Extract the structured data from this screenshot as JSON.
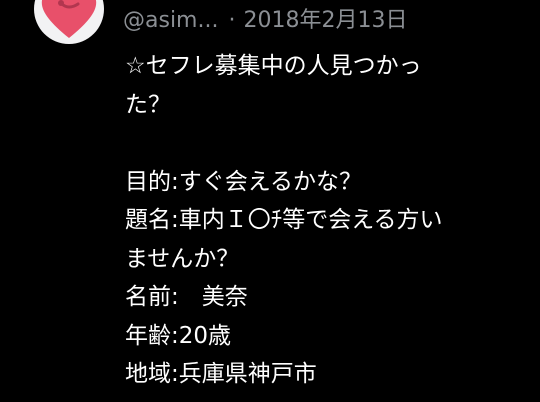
{
  "tweet": {
    "username": "@asim...",
    "separator": "·",
    "date": "2018年2月13日",
    "lines": [
      "☆セフレ募集中の人見つかっ",
      "た？",
      "",
      "目的:すぐ会えるかな？",
      "題名:車内Ｉ〇ﾁ等で会える方い",
      "ませんか？",
      "名前:　美奈",
      "年齢:20歳",
      "地域:兵庫県神戸市"
    ]
  },
  "avatar": {
    "icon": "heart-icon",
    "heart_color": "#e8506a",
    "background": "#f2f2f4"
  },
  "colors": {
    "background": "#000000",
    "text": "#ffffff",
    "meta": "#8b8f94"
  }
}
